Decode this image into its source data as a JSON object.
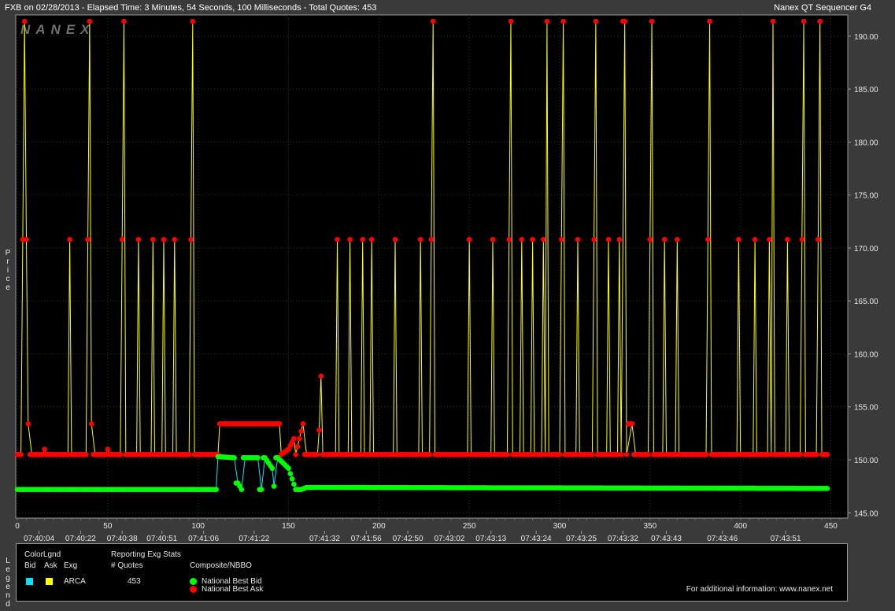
{
  "header": {
    "left": "FXB on 02/28/2013  -  Elapsed Time: 3 Minutes, 54 Seconds, 100 Milliseconds  -  Total Quotes: 453",
    "right": "Nanex QT Sequencer G4"
  },
  "watermark": "NANEX",
  "side_labels": {
    "price": "P\nr\ni\nc\ne",
    "legend": "L\ne\ng\ne\nn\nd"
  },
  "legend": {
    "color_legend_title": "ColorLgnd",
    "bid_header": "Bid",
    "ask_header": "Ask",
    "exg_header": "Exg",
    "bid_color": "#00e5ff",
    "ask_color": "#ffff00",
    "exchange": "ARCA",
    "stats_title": "Reporting Exg Stats",
    "quotes_header": "# Quotes",
    "quotes_value": "453",
    "composite_title": "Composite/NBBO",
    "nbb_label": "National Best Bid",
    "nbb_color": "#00ff00",
    "nba_label": "National Best Ask",
    "nba_color": "#ff0000",
    "footer": "For additional information: www.nanex.net"
  },
  "chart_data": {
    "type": "line",
    "title": "",
    "xlabel": "",
    "ylabel": "Price",
    "xlim": [
      0,
      455
    ],
    "ylim": [
      144.5,
      192.0
    ],
    "grid": true,
    "x_ticks": [
      "0",
      "50",
      "100",
      "150",
      "200",
      "250",
      "300",
      "350",
      "400",
      "450"
    ],
    "y_ticks": [
      "145.00",
      "150.00",
      "155.00",
      "160.00",
      "165.00",
      "170.00",
      "175.00",
      "180.00",
      "185.00",
      "190.00"
    ],
    "time_labels": [
      {
        "x": 12,
        "label": "07:40:04"
      },
      {
        "x": 35,
        "label": "07:40:22"
      },
      {
        "x": 58,
        "label": "07:40:38"
      },
      {
        "x": 80,
        "label": "07:40:51"
      },
      {
        "x": 103,
        "label": "07:41:06"
      },
      {
        "x": 131,
        "label": "07:41:22"
      },
      {
        "x": 170,
        "label": "07:41:32"
      },
      {
        "x": 193,
        "label": "07:41:56"
      },
      {
        "x": 216,
        "label": "07:42:50"
      },
      {
        "x": 239,
        "label": "07:43:02"
      },
      {
        "x": 262,
        "label": "07:43:13"
      },
      {
        "x": 287,
        "label": "07:43:24"
      },
      {
        "x": 312,
        "label": "07:43:25"
      },
      {
        "x": 335,
        "label": "07:43:32"
      },
      {
        "x": 359,
        "label": "07:43:43"
      },
      {
        "x": 390,
        "label": "07:43:46"
      },
      {
        "x": 425,
        "label": "07:43:51"
      }
    ],
    "series": [
      {
        "name": "National Best Ask",
        "color": "#ff0000",
        "data": [
          [
            0,
            150.5
          ],
          [
            2,
            150.5
          ],
          [
            3,
            170.8
          ],
          [
            4,
            191.4
          ],
          [
            5,
            170.8
          ],
          [
            6,
            153.4
          ],
          [
            8,
            150.5
          ],
          [
            14,
            150.5
          ],
          [
            15,
            151.0
          ],
          [
            16,
            150.5
          ],
          [
            28,
            150.5
          ],
          [
            29,
            170.8
          ],
          [
            30,
            150.5
          ],
          [
            38,
            150.5
          ],
          [
            39,
            170.8
          ],
          [
            40,
            191.4
          ],
          [
            41,
            153.4
          ],
          [
            43,
            150.5
          ],
          [
            49,
            150.5
          ],
          [
            50,
            151.0
          ],
          [
            51,
            150.5
          ],
          [
            57,
            150.5
          ],
          [
            58,
            170.8
          ],
          [
            59,
            191.4
          ],
          [
            60,
            150.5
          ],
          [
            66,
            150.5
          ],
          [
            67,
            170.8
          ],
          [
            68,
            150.5
          ],
          [
            74,
            150.5
          ],
          [
            75,
            170.8
          ],
          [
            76,
            150.5
          ],
          [
            80,
            150.5
          ],
          [
            81,
            170.8
          ],
          [
            82,
            150.5
          ],
          [
            86,
            150.5
          ],
          [
            87,
            170.8
          ],
          [
            88,
            150.5
          ],
          [
            95,
            150.5
          ],
          [
            96,
            170.8
          ],
          [
            97,
            191.4
          ],
          [
            98,
            150.5
          ],
          [
            111,
            150.5
          ],
          [
            112,
            153.4
          ],
          [
            145,
            153.4
          ],
          [
            146,
            150.5
          ],
          [
            150,
            151.0
          ],
          [
            153,
            152.0
          ],
          [
            154,
            150.5
          ],
          [
            156,
            152.0
          ],
          [
            158,
            153.4
          ],
          [
            160,
            150.5
          ],
          [
            166,
            150.5
          ],
          [
            167,
            152.8
          ],
          [
            168,
            157.9
          ],
          [
            169,
            150.5
          ],
          [
            176,
            150.5
          ],
          [
            177,
            170.8
          ],
          [
            178,
            150.5
          ],
          [
            183,
            150.5
          ],
          [
            184,
            170.8
          ],
          [
            185,
            150.5
          ],
          [
            190,
            150.5
          ],
          [
            191,
            170.8
          ],
          [
            192,
            150.5
          ],
          [
            195,
            150.5
          ],
          [
            196,
            170.8
          ],
          [
            197,
            150.5
          ],
          [
            208,
            150.5
          ],
          [
            209,
            170.8
          ],
          [
            210,
            150.5
          ],
          [
            222,
            150.5
          ],
          [
            223,
            170.8
          ],
          [
            224,
            150.5
          ],
          [
            228,
            150.5
          ],
          [
            229,
            170.8
          ],
          [
            230,
            191.4
          ],
          [
            231,
            150.5
          ],
          [
            249,
            150.5
          ],
          [
            250,
            170.8
          ],
          [
            251,
            150.5
          ],
          [
            262,
            150.5
          ],
          [
            263,
            170.8
          ],
          [
            264,
            150.5
          ],
          [
            271,
            150.5
          ],
          [
            272,
            170.8
          ],
          [
            273,
            191.4
          ],
          [
            274,
            150.5
          ],
          [
            278,
            150.5
          ],
          [
            279,
            170.8
          ],
          [
            280,
            150.5
          ],
          [
            284,
            150.5
          ],
          [
            285,
            170.8
          ],
          [
            286,
            150.5
          ],
          [
            290,
            150.5
          ],
          [
            291,
            170.8
          ],
          [
            292,
            150.5
          ],
          [
            293,
            191.4
          ],
          [
            294,
            150.5
          ],
          [
            300,
            150.5
          ],
          [
            301,
            170.8
          ],
          [
            302,
            191.4
          ],
          [
            303,
            150.5
          ],
          [
            309,
            150.5
          ],
          [
            310,
            170.8
          ],
          [
            311,
            150.5
          ],
          [
            318,
            150.5
          ],
          [
            319,
            170.8
          ],
          [
            320,
            191.4
          ],
          [
            321,
            150.5
          ],
          [
            326,
            150.5
          ],
          [
            327,
            170.8
          ],
          [
            328,
            150.5
          ],
          [
            332,
            150.5
          ],
          [
            333,
            170.8
          ],
          [
            334,
            150.5
          ],
          [
            336,
            191.4
          ],
          [
            337,
            150.5
          ],
          [
            340,
            153.4
          ],
          [
            342,
            150.5
          ],
          [
            349,
            150.5
          ],
          [
            350,
            170.8
          ],
          [
            351,
            191.4
          ],
          [
            352,
            150.5
          ],
          [
            357,
            150.5
          ],
          [
            358,
            170.8
          ],
          [
            359,
            150.5
          ],
          [
            364,
            150.5
          ],
          [
            365,
            170.8
          ],
          [
            366,
            150.5
          ],
          [
            381,
            150.5
          ],
          [
            382,
            170.8
          ],
          [
            383,
            191.4
          ],
          [
            384,
            150.5
          ],
          [
            398,
            150.5
          ],
          [
            399,
            170.8
          ],
          [
            400,
            150.5
          ],
          [
            407,
            150.5
          ],
          [
            408,
            170.8
          ],
          [
            409,
            150.5
          ],
          [
            415,
            150.5
          ],
          [
            416,
            170.8
          ],
          [
            417,
            150.5
          ],
          [
            418,
            191.4
          ],
          [
            419,
            150.5
          ],
          [
            425,
            150.5
          ],
          [
            426,
            170.8
          ],
          [
            427,
            150.5
          ],
          [
            433,
            150.5
          ],
          [
            434,
            170.8
          ],
          [
            435,
            191.4
          ],
          [
            436,
            150.5
          ],
          [
            442,
            150.5
          ],
          [
            443,
            170.8
          ],
          [
            444,
            191.4
          ],
          [
            445,
            150.5
          ],
          [
            448,
            150.5
          ]
        ]
      },
      {
        "name": "National Best Bid",
        "color": "#00ff00",
        "data": [
          [
            0,
            147.2
          ],
          [
            110,
            147.2
          ],
          [
            111,
            150.3
          ],
          [
            120,
            150.2
          ],
          [
            122,
            147.8
          ],
          [
            124,
            147.2
          ],
          [
            126,
            150.2
          ],
          [
            133,
            150.2
          ],
          [
            135,
            147.2
          ],
          [
            137,
            150.2
          ],
          [
            141,
            149.2
          ],
          [
            142,
            147.5
          ],
          [
            144,
            150.2
          ],
          [
            150,
            149.2
          ],
          [
            154,
            147.2
          ],
          [
            157,
            147.2
          ],
          [
            160,
            147.4
          ],
          [
            448,
            147.3
          ]
        ]
      }
    ],
    "annotations": []
  }
}
